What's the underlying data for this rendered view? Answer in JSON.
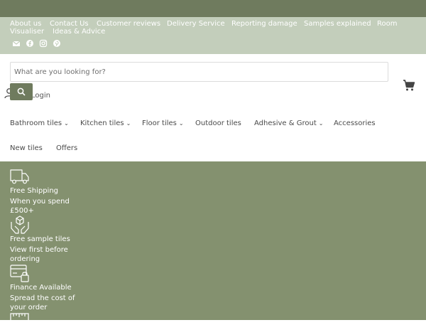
{
  "utility_nav": {
    "links": [
      "About us",
      "Contact Us",
      "Customer reviews",
      "Delivery Service",
      "Reporting damage",
      "Samples explained",
      "Room",
      "Visualiser",
      "Ideas & Advice"
    ]
  },
  "social": [
    "email-icon",
    "facebook-icon",
    "instagram-icon",
    "pinterest-icon"
  ],
  "search": {
    "placeholder": "What are you looking for?"
  },
  "account": {
    "label": "Login"
  },
  "main_nav": {
    "items": [
      {
        "label": "Bathroom tiles",
        "chevron": "⌄"
      },
      {
        "label": "Kitchen tiles",
        "chevron": "⌄"
      },
      {
        "label": "Floor tiles",
        "chevron": "⌄"
      },
      {
        "label": "Outdoor tiles"
      },
      {
        "label": "Adhesive & Grout",
        "chevron": "⌄"
      },
      {
        "label": "Accessories"
      },
      {
        "label": "New tiles"
      },
      {
        "label": "Offers"
      }
    ]
  },
  "features": [
    {
      "icon": "delivery-truck-icon",
      "title": "Free Shipping",
      "subtitle": "When you spend £500+"
    },
    {
      "icon": "sample-box-icon",
      "title": "Free sample tiles",
      "subtitle": "View first before ordering"
    },
    {
      "icon": "finance-card-icon",
      "title": "Finance Available",
      "subtitle": "Spread the cost of your order"
    },
    {
      "icon": "ruler-icon"
    }
  ],
  "colors": {
    "topbar": "#6f7b5e",
    "utility": "#c3cebb",
    "features": "#84916f",
    "nav_text": "#4a4a4a"
  }
}
